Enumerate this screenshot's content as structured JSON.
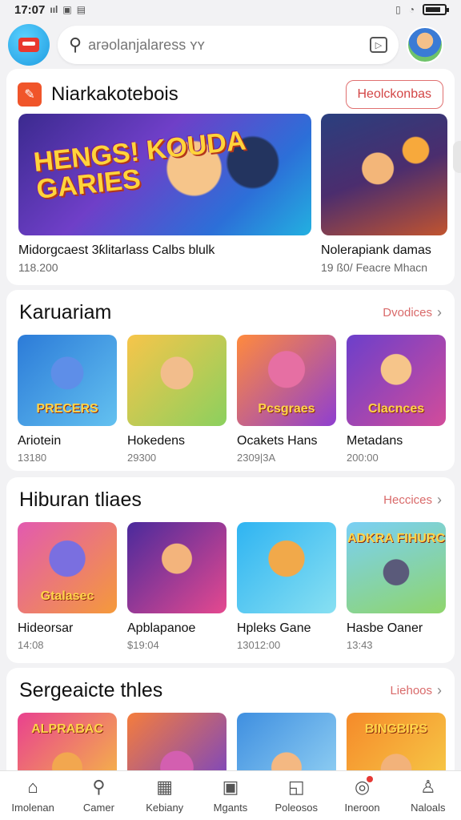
{
  "status_bar": {
    "time": "17:07",
    "signal": "ııl"
  },
  "header": {
    "search_placeholder": "arəolanjalaress ʏʏ"
  },
  "featured": {
    "title": "Niarkakotebois",
    "button_label": "Heolckonbas",
    "items": [
      {
        "name": "Midorgcaest 3ƙlitarlass Calbs blulk",
        "meta": "118.200",
        "art_text": "HENGS! KOUDA GARIES"
      },
      {
        "name": "Nolerapiank damas",
        "meta": "19 ß0/ Feacre Mhacn"
      }
    ]
  },
  "sections": [
    {
      "title": "Karuariam",
      "more_label": "Dvodices",
      "items": [
        {
          "name": "Ariotein",
          "meta": "13180",
          "art_text": "PRECERS"
        },
        {
          "name": "Hokedens",
          "meta": "29300",
          "art_text": ""
        },
        {
          "name": "Ocakets Hans",
          "meta": "2309|3A",
          "art_text": "Pcsgraes"
        },
        {
          "name": "Metadans",
          "meta": "200:00",
          "art_text": "Clacnces"
        }
      ]
    },
    {
      "title": "Hiburan tliaes",
      "more_label": "Heccices",
      "items": [
        {
          "name": "Hideorsar",
          "meta": "14:08",
          "art_text": "Gtalasec"
        },
        {
          "name": "Apblapanoe",
          "meta": "$19:04",
          "art_text": ""
        },
        {
          "name": "Hpleks Gane",
          "meta": "13012:00",
          "art_text": ""
        },
        {
          "name": "Hasbe Oaner",
          "meta": "13:43",
          "art_text": "ADKRA FIHURC"
        }
      ]
    },
    {
      "title": "Sergeaicte thles",
      "more_label": "Liehoos",
      "items": [
        {
          "name": "",
          "meta": "",
          "art_text": "ALPRABAC"
        },
        {
          "name": "",
          "meta": "",
          "art_text": ""
        },
        {
          "name": "",
          "meta": "",
          "art_text": ""
        },
        {
          "name": "",
          "meta": "",
          "art_text": "BINGBIRS"
        }
      ]
    }
  ],
  "bottom_nav": [
    {
      "label": "Imolenan",
      "icon": "home-icon"
    },
    {
      "label": "Camer",
      "icon": "search-icon"
    },
    {
      "label": "Kebiany",
      "icon": "library-icon"
    },
    {
      "label": "Mgants",
      "icon": "games-icon"
    },
    {
      "label": "Poleosos",
      "icon": "chat-icon"
    },
    {
      "label": "Ineroon",
      "icon": "notification-icon"
    },
    {
      "label": "Naloals",
      "icon": "profile-icon"
    }
  ],
  "colors": {
    "accent": "#d96a6a",
    "background": "#f2f2f4",
    "logo": "#1e9be0"
  }
}
